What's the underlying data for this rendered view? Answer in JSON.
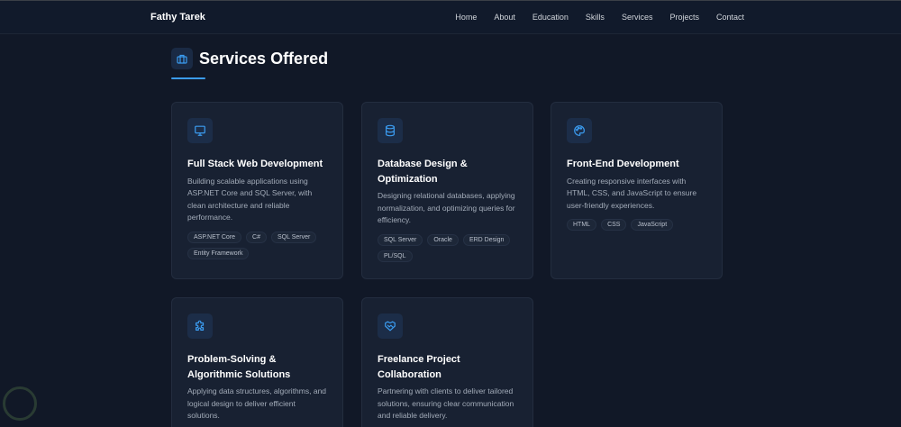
{
  "nav": {
    "brand": "Fathy Tarek",
    "links": [
      "Home",
      "About",
      "Education",
      "Skills",
      "Services",
      "Projects",
      "Contact"
    ]
  },
  "section": {
    "title": "Services Offered",
    "icon": "briefcase-icon"
  },
  "accent": "#3b9cf0",
  "cards": [
    {
      "icon": "monitor-icon",
      "title": "Full Stack Web Development",
      "desc": "Building scalable applications using ASP.NET Core and SQL Server, with clean architecture and reliable performance.",
      "tags": [
        "ASP.NET Core",
        "C#",
        "SQL Server",
        "Entity Framework"
      ]
    },
    {
      "icon": "database-icon",
      "title": "Database Design & Optimization",
      "desc": "Designing relational databases, applying normalization, and optimizing queries for efficiency.",
      "tags": [
        "SQL Server",
        "Oracle",
        "ERD Design",
        "PL/SQL"
      ]
    },
    {
      "icon": "palette-icon",
      "title": "Front-End Development",
      "desc": "Creating responsive interfaces with HTML, CSS, and JavaScript to ensure user-friendly experiences.",
      "tags": [
        "HTML",
        "CSS",
        "JavaScript"
      ]
    },
    {
      "icon": "puzzle-icon",
      "title": "Problem-Solving & Algorithmic Solutions",
      "desc": "Applying data structures, algorithms, and logical design to deliver efficient solutions.",
      "tags": []
    },
    {
      "icon": "handshake-icon",
      "title": "Freelance Project Collaboration",
      "desc": "Partnering with clients to deliver tailored solutions, ensuring clear communication and reliable delivery.",
      "tags": []
    }
  ]
}
